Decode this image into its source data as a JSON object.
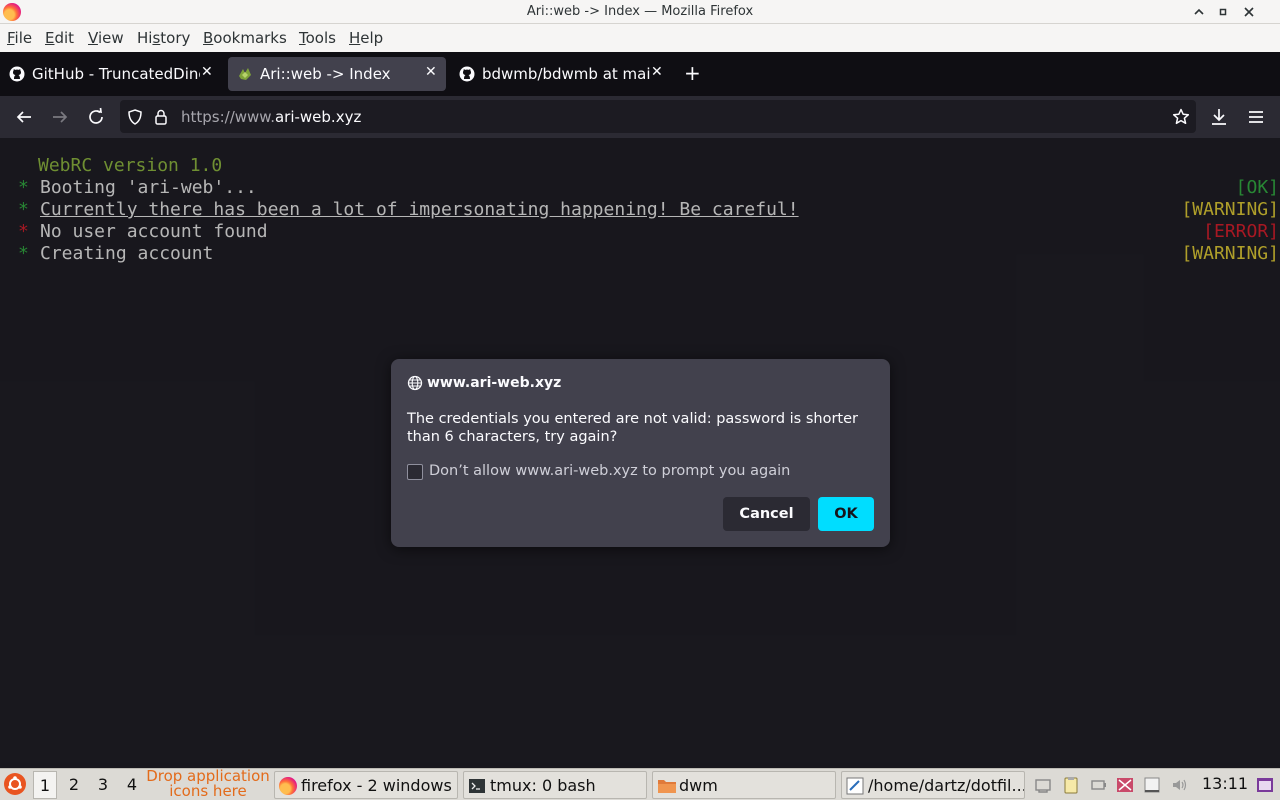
{
  "window": {
    "title": "Ari::web -> Index — Mozilla Firefox",
    "controls": [
      "minimize-icon",
      "maximize-icon",
      "close-icon"
    ]
  },
  "menubar": {
    "items": [
      {
        "label": "File",
        "u": "F",
        "rest": "ile"
      },
      {
        "label": "Edit",
        "u": "E",
        "rest": "dit"
      },
      {
        "label": "View",
        "u": "V",
        "rest": "iew"
      },
      {
        "label": "History",
        "u": "",
        "pre": "Hi",
        "us": "s",
        "post": "tory"
      },
      {
        "label": "Bookmarks",
        "u": "B",
        "rest": "ookmarks"
      },
      {
        "label": "Tools",
        "u": "T",
        "rest": "ools"
      },
      {
        "label": "Help",
        "u": "H",
        "rest": "elp"
      }
    ]
  },
  "tabs": [
    {
      "label": "GitHub - TruncatedDinc",
      "icon": "github-icon",
      "active": false
    },
    {
      "label": "Ari::web -> Index",
      "icon": "site-favicon-icon",
      "active": true
    },
    {
      "label": "bdwmb/bdwmb at mai",
      "icon": "github-icon",
      "active": false
    }
  ],
  "navbar": {
    "url_prefix": "https://www.",
    "url_domain": "ari-web.xyz"
  },
  "content": {
    "version_line": "WebRC version 1.0",
    "lines": [
      {
        "star": "*",
        "text": "Booting 'ari-web'...",
        "status": "[OK]"
      },
      {
        "star": "*",
        "text": "Currently there has been a lot of impersonating happening! Be careful!",
        "status": "[WARNING]"
      },
      {
        "star": "*",
        "text": "No user account found",
        "status": "[ERROR]"
      },
      {
        "star": "*",
        "text": "Creating account",
        "status": "[WARNING]"
      }
    ],
    "colors": {
      "version": "#7fa33a",
      "star_ok": "#2e9a3c",
      "star_err": "#c01c28",
      "ok": "#2e9a3c",
      "warning": "#c8b630",
      "error": "#c01c28",
      "text": "#d0d0d0"
    }
  },
  "dialog": {
    "host": "www.ari-web.xyz",
    "message": "The credentials you entered are not valid: password is shorter than 6 characters, try again?",
    "checkbox_label": "Don’t allow www.ari-web.xyz to prompt you again",
    "checkbox_checked": false,
    "cancel_label": "Cancel",
    "ok_label": "OK"
  },
  "taskbar": {
    "workspaces": [
      "1",
      "2",
      "3",
      "4"
    ],
    "current_workspace": "1",
    "drop_text": "Drop application icons here",
    "tasks": [
      {
        "label": "firefox - 2 windows",
        "icon": "firefox-icon"
      },
      {
        "label": "tmux: 0 bash",
        "icon": "terminal-icon"
      },
      {
        "label": "dwm",
        "icon": "folder-icon"
      },
      {
        "label": "/home/dartz/dotfil...",
        "icon": "text-editor-icon"
      }
    ],
    "clock": "13:11"
  }
}
